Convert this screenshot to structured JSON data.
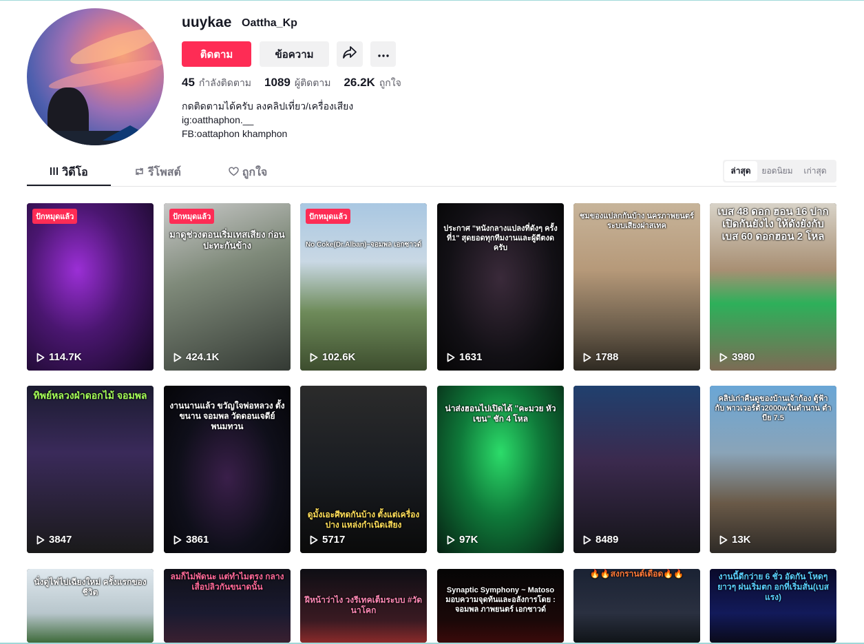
{
  "profile": {
    "username": "uuykae",
    "nickname": "Oattha_Kp",
    "follow_label": "ติดตาม",
    "message_label": "ข้อความ",
    "stats": [
      {
        "value": "45",
        "label": "กำลังติดตาม"
      },
      {
        "value": "1089",
        "label": "ผู้ติดตาม"
      },
      {
        "value": "26.2K",
        "label": "ถูกใจ"
      }
    ],
    "bio": [
      "กดติดตามได้ครับ ลงคลิปเที่ยว/เครื่องเสียง",
      "ig:oatthaphon.__",
      "FB:oattaphon khamphon"
    ]
  },
  "tabs": [
    {
      "label": "วิดีโอ",
      "icon": "grid-icon"
    },
    {
      "label": "รีโพสต์",
      "icon": "repost-icon"
    },
    {
      "label": "ถูกใจ",
      "icon": "heart-icon"
    }
  ],
  "sort": [
    "ล่าสุด",
    "ยอดนิยม",
    "เก่าสุด"
  ],
  "pinned_label": "ปักหมุดแล้ว",
  "videos": [
    {
      "views": "114.7K",
      "pinned": true,
      "caption": ""
    },
    {
      "views": "424.1K",
      "pinned": true,
      "caption": "มาดูช่วงตอนเริ่มเทสเสียง ก่อนปะทะกันข้าง"
    },
    {
      "views": "102.6K",
      "pinned": true,
      "caption": "No Coke(Dr.Alban)~จอมพล เอกซาวด์"
    },
    {
      "views": "1631",
      "pinned": false,
      "caption": "ประกาศ \"หนังกลางแปลงที่ดังๆ ครั้งที่1\" สุดยอดทุกทีมงานและผู้ดีตงดครับ"
    },
    {
      "views": "1788",
      "pinned": false,
      "caption": "ชมของแปลกกันบ้าง นครภาพยนตร์ ระบบเสียงฝาสเทค"
    },
    {
      "views": "3980",
      "pinned": false,
      "caption": "เบส 48 ดอก ฮอน 16 ปาก เปิดกันยังไง ให้ดังยังกับ เบส 60 ดอกฮอน 2 โหล"
    },
    {
      "views": "3847",
      "pinned": false,
      "caption": "ทิพย์หลวงฝ่าดอกไม้ จอมพล"
    },
    {
      "views": "3861",
      "pinned": false,
      "caption": "งานนานแล้ว ขวัญใจพ่อหลวง ตั้งขนาน จอมพล วัดดอนเจดีย์ พนมทวน"
    },
    {
      "views": "5717",
      "pinned": false,
      "caption": "ดูมั้งเอะศีทดกันบ้าง ตั้งแต่เครื่องปาง แหล่งกำเนิดเสียง"
    },
    {
      "views": "97K",
      "pinned": false,
      "caption": "น่าส่งฮอนไปเปิดได้ \"คะมวย หัวเขน\" ชัก 4 โหล"
    },
    {
      "views": "8489",
      "pinned": false,
      "caption": ""
    },
    {
      "views": "13K",
      "pinned": false,
      "caption": "คลิปเก่าคืนดูของบ้านเจ้าก้อง ตู้ฟ้ากับ พาวเวอร์ตัว2000wในตำนาน ตำบีย 7.5"
    },
    {
      "views": "",
      "pinned": false,
      "caption": "นั่งดูไฟไปเฉียงใหม่ ครั้งแรกของชีวิต"
    },
    {
      "views": "",
      "pinned": false,
      "caption": "ลมก็ไม่พัดนะ แต่ทำไมตรง กลางเสื่อปลิวกันขนาดนั้น"
    },
    {
      "views": "",
      "pinned": false,
      "caption": "ฝีหน้าว่าไง วงรีเทคเต็มระบบ #วัดนาโคก"
    },
    {
      "views": "",
      "pinned": false,
      "caption": "Synaptic Symphony ~ Matoso มอบความจุดท้นและอลังการโดย : จอมพล ภาพยนตร์ เอกซาวด์"
    },
    {
      "views": "",
      "pinned": false,
      "caption": "🔥🔥สงกรานต์เดือด🔥🔥"
    },
    {
      "views": "",
      "pinned": false,
      "caption": "งานนี้ดีกว่าย 6 ชั่ว อัดกัน โหดๆยาวๆ ฝนเริ่มตก อกที่เริ่มสั่น(เบสแรง)"
    }
  ]
}
